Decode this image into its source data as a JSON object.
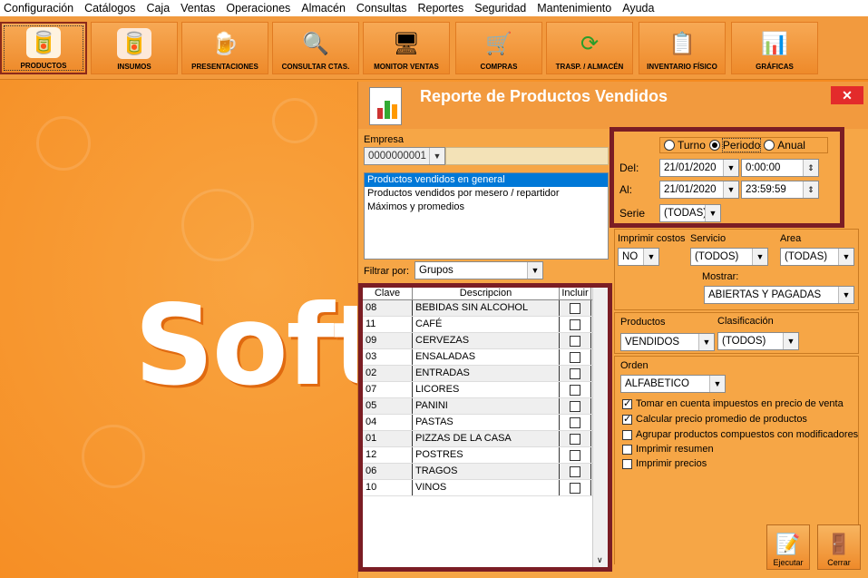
{
  "menu": [
    "Configuración",
    "Catálogos",
    "Caja",
    "Ventas",
    "Operaciones",
    "Almacén",
    "Consultas",
    "Reportes",
    "Seguridad",
    "Mantenimiento",
    "Ayuda"
  ],
  "toolbar": {
    "f5": "F5",
    "buttons": [
      {
        "label": "PRODUCTOS",
        "icon": "products-icon"
      },
      {
        "label": "INSUMOS",
        "icon": "supplies-icon"
      },
      {
        "label": "PRESENTACIONES",
        "icon": "presentations-icon"
      },
      {
        "label": "CONSULTAR CTAS.",
        "icon": "check-accounts-icon"
      },
      {
        "label": "MONITOR VENTAS",
        "icon": "sales-monitor-icon"
      },
      {
        "label": "COMPRAS",
        "icon": "cart-icon"
      },
      {
        "label": "TRASP. / ALMACÉN",
        "icon": "transfer-icon"
      },
      {
        "label": "INVENTARIO FÍSICO",
        "icon": "clipboard-icon"
      },
      {
        "label": "GRÁFICAS",
        "icon": "chart-icon"
      }
    ]
  },
  "background": {
    "brand": "Soft"
  },
  "dialog": {
    "title": "Reporte de Productos Vendidos",
    "close": "✕",
    "empresa_label": "Empresa",
    "empresa_value": "0000000001",
    "report_types": [
      "Productos vendidos en general",
      "Productos vendidos por mesero / repartidor",
      "Máximos y promedios"
    ],
    "filtrar_label": "Filtrar por:",
    "filtrar_value": "Grupos",
    "grid": {
      "headers": [
        "Clave",
        "Descripcion",
        "Incluir"
      ],
      "rows": [
        {
          "clave": "08",
          "desc": "BEBIDAS SIN ALCOHOL"
        },
        {
          "clave": "11",
          "desc": "CAFÉ"
        },
        {
          "clave": "09",
          "desc": "CERVEZAS"
        },
        {
          "clave": "03",
          "desc": "ENSALADAS"
        },
        {
          "clave": "02",
          "desc": "ENTRADAS"
        },
        {
          "clave": "07",
          "desc": "LICORES"
        },
        {
          "clave": "05",
          "desc": "PANINI"
        },
        {
          "clave": "04",
          "desc": "PASTAS"
        },
        {
          "clave": "01",
          "desc": "PIZZAS DE LA CASA"
        },
        {
          "clave": "12",
          "desc": "POSTRES"
        },
        {
          "clave": "06",
          "desc": "TRAGOS"
        },
        {
          "clave": "10",
          "desc": "VINOS"
        }
      ]
    },
    "period": {
      "options": [
        "Turno",
        "Periodo",
        "Anual"
      ],
      "selected": "Periodo",
      "del_label": "Del:",
      "del_date": "21/01/2020",
      "del_time": "0:00:00",
      "al_label": "Al:",
      "al_date": "21/01/2020",
      "al_time": "23:59:59",
      "serie_label": "Serie",
      "serie_value": "(TODAS)"
    },
    "options": {
      "imprimir_costos_label": "Imprimir costos",
      "imprimir_costos_value": "NO",
      "servicio_label": "Servicio",
      "servicio_value": "(TODOS)",
      "area_label": "Area",
      "area_value": "(TODAS)",
      "mostrar_label": "Mostrar:",
      "mostrar_value": "ABIERTAS Y PAGADAS",
      "productos_label": "Productos",
      "productos_value": "VENDIDOS",
      "clasificacion_label": "Clasificación",
      "clasificacion_value": "(TODOS)",
      "orden_label": "Orden",
      "orden_value": "ALFABETICO",
      "checks": [
        {
          "label": "Tomar en cuenta impuestos en precio de venta",
          "checked": true
        },
        {
          "label": "Calcular precio promedio de productos",
          "checked": true
        },
        {
          "label": "Agrupar productos compuestos con modificadores",
          "checked": false
        },
        {
          "label": "Imprimir resumen",
          "checked": false
        },
        {
          "label": "Imprimir precios",
          "checked": false
        }
      ]
    },
    "actions": {
      "execute": "Ejecutar",
      "close": "Cerrar"
    }
  }
}
